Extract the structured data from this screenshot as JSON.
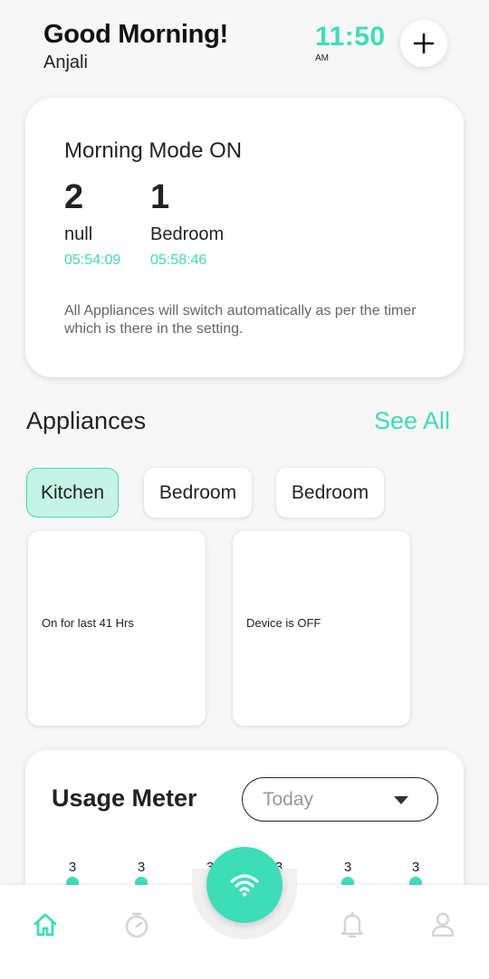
{
  "header": {
    "greeting": "Good Morning!",
    "username": "Anjali",
    "time": "11:50",
    "ampm": "AM"
  },
  "mode_card": {
    "title": "Morning Mode ON",
    "stats": [
      {
        "count": "2",
        "label": "null",
        "time": "05:54:09"
      },
      {
        "count": "1",
        "label": "Bedroom",
        "time": "05:58:46"
      }
    ],
    "description": "All Appliances will switch automatically as per the timer which is there in the setting."
  },
  "appliances": {
    "title": "Appliances",
    "see_all": "See All",
    "rooms": [
      "Kitchen",
      "Bedroom",
      "Bedroom"
    ],
    "devices": [
      {
        "status": "On for last 41 Hrs"
      },
      {
        "status": "Device is OFF"
      }
    ]
  },
  "usage": {
    "title": "Usage Meter",
    "period": "Today",
    "values": [
      "3",
      "3",
      "3",
      "3",
      "3",
      "3"
    ]
  },
  "colors": {
    "accent": "#3dddb8",
    "chip_active": "#c5f3e6"
  },
  "nav": [
    "home-icon",
    "timer-icon",
    "wifi-icon",
    "bell-icon",
    "user-icon"
  ]
}
